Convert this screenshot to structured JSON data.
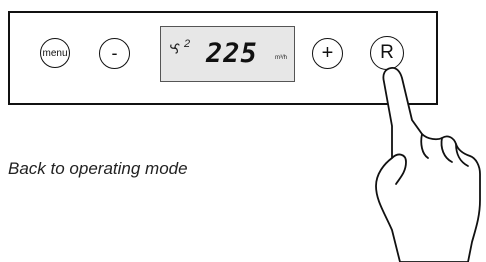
{
  "control_panel": {
    "buttons": {
      "menu_label": "menu",
      "minus_label": "-",
      "plus_label": "+",
      "reset_label": "R"
    },
    "display": {
      "fan_icon": "fan-icon",
      "fan_level": "2",
      "value": "225",
      "unit": "m³/h"
    }
  },
  "caption": {
    "text": "Back to operating mode"
  },
  "illustration": {
    "hand_icon": "pointing-hand-icon",
    "pressed_button": "R"
  }
}
